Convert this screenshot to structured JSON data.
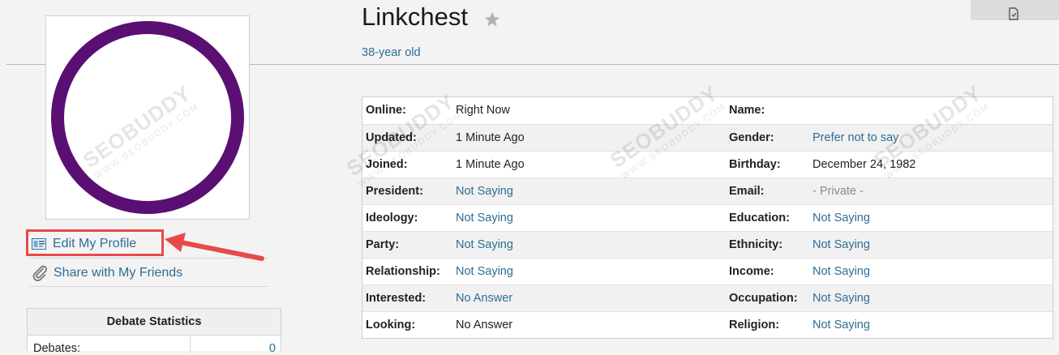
{
  "profile": {
    "name": "Linkchest",
    "age": "38-year old"
  },
  "actions": {
    "edit_profile": "Edit My Profile",
    "share": "Share with My Friends"
  },
  "stats": {
    "title": "Debate Statistics",
    "rows": [
      {
        "label": "Debates:",
        "value": "0"
      }
    ]
  },
  "info": {
    "rows": [
      {
        "l1": "Online:",
        "v1": "Right Now",
        "l2": "Name:",
        "v2": ""
      },
      {
        "l1": "Updated:",
        "v1": "1 Minute Ago",
        "l2": "Gender:",
        "v2": "Prefer not to say"
      },
      {
        "l1": "Joined:",
        "v1": "1 Minute Ago",
        "l2": "Birthday:",
        "v2": "December 24, 1982"
      },
      {
        "l1": "President:",
        "v1": "Not Saying",
        "l2": "Email:",
        "v2": "- Private -"
      },
      {
        "l1": "Ideology:",
        "v1": "Not Saying",
        "l2": "Education:",
        "v2": "Not Saying"
      },
      {
        "l1": "Party:",
        "v1": "Not Saying",
        "l2": "Ethnicity:",
        "v2": "Not Saying"
      },
      {
        "l1": "Relationship:",
        "v1": "Not Saying",
        "l2": "Income:",
        "v2": "Not Saying"
      },
      {
        "l1": "Interested:",
        "v1": "No Answer",
        "l2": "Occupation:",
        "v2": "Not Saying"
      },
      {
        "l1": "Looking:",
        "v1": "No Answer",
        "l2": "Religion:",
        "v2": "Not Saying"
      }
    ]
  },
  "watermark": {
    "brand": "SEOBUDDY",
    "site": "WWW.SEOBUDDY.COM"
  },
  "icons": {
    "avatar": "purple-ring",
    "star": "star-icon",
    "edit": "profile-card-icon",
    "share": "paperclip-icon",
    "corner": "document-icon"
  },
  "colors": {
    "link": "#2c6e94",
    "avatar_ring": "#5a0f73",
    "highlight": "#e84a4a"
  }
}
